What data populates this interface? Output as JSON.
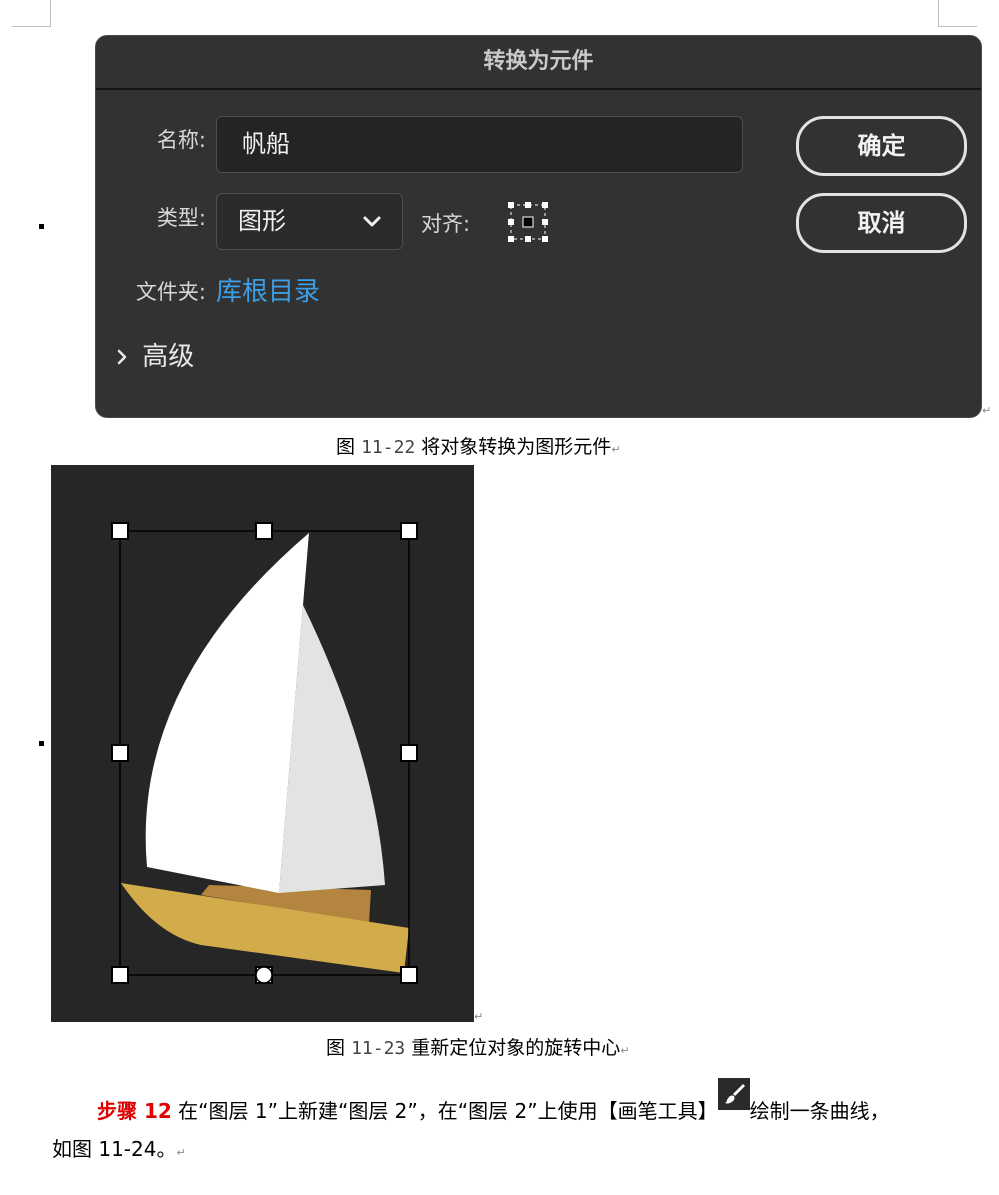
{
  "dialog": {
    "title": "转换为元件",
    "name_label": "名称:",
    "name_value": "帆船",
    "type_label": "类型:",
    "type_value": "图形",
    "align_label": "对齐:",
    "folder_label": "文件夹:",
    "folder_value": "库根目录",
    "advanced_label": "高级",
    "ok_label": "确定",
    "cancel_label": "取消",
    "colors": {
      "background": "#323232",
      "link": "#3d9ee8"
    },
    "icons": [
      "chevron-down-icon",
      "registration-grid-icon",
      "chevron-right-icon"
    ]
  },
  "caption1": {
    "prefix": "图",
    "number": "11-22",
    "text": "将对象转换为图形元件"
  },
  "caption2": {
    "prefix": "图",
    "number": "11-23",
    "text": "重新定位对象的旋转中心"
  },
  "illustration": {
    "colors": {
      "background": "#262626",
      "sail_main": "#ffffff",
      "sail_jib": "#e3e3e3",
      "hull": "#d2ac4b",
      "deck": "#b3853e"
    }
  },
  "paragraph": {
    "step_label": "步骤 12",
    "line1_a": "在“图层 1”上新建“图层 2”，在“图层 2”上使用【画笔工具】",
    "line1_b": "绘制一条曲线，",
    "line2": "如图 11-24。",
    "icon": "brush-tool-icon"
  }
}
